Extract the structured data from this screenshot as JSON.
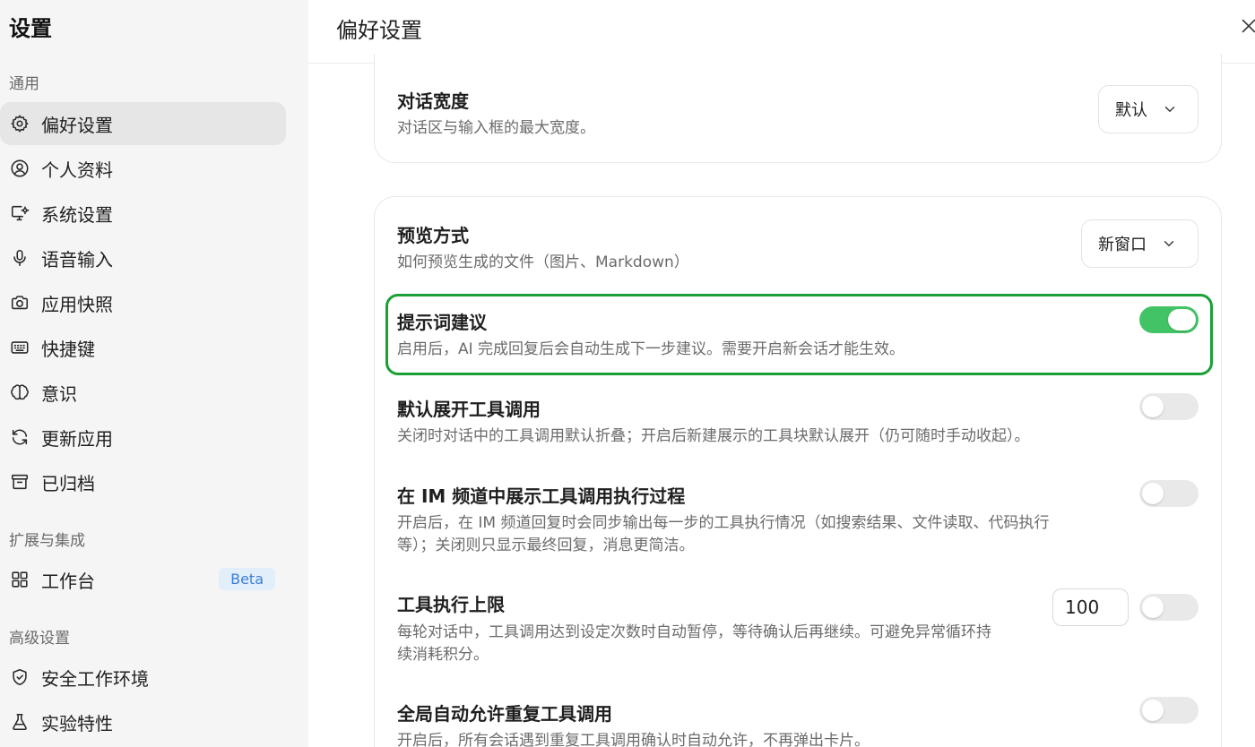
{
  "sidebar": {
    "title": "设置",
    "sections": {
      "general": "通用",
      "extensions": "扩展与集成",
      "advanced": "高级设置"
    },
    "items": [
      {
        "label": "偏好设置",
        "icon": "gear-icon"
      },
      {
        "label": "个人资料",
        "icon": "user-circle-icon"
      },
      {
        "label": "系统设置",
        "icon": "monitor-gear-icon"
      },
      {
        "label": "语音输入",
        "icon": "microphone-icon"
      },
      {
        "label": "应用快照",
        "icon": "camera-icon"
      },
      {
        "label": "快捷键",
        "icon": "keyboard-icon"
      },
      {
        "label": "意识",
        "icon": "brain-icon"
      },
      {
        "label": "更新应用",
        "icon": "refresh-icon"
      },
      {
        "label": "已归档",
        "icon": "archive-icon"
      },
      {
        "label": "工作台",
        "icon": "grid-icon",
        "badge": "Beta"
      },
      {
        "label": "安全工作环境",
        "icon": "shield-icon"
      },
      {
        "label": "实验特性",
        "icon": "flask-icon"
      }
    ]
  },
  "main": {
    "title": "偏好设置",
    "chat_width": {
      "title": "对话宽度",
      "desc": "对话区与输入框的最大宽度。",
      "value": "默认"
    },
    "preview": {
      "title": "预览方式",
      "desc": "如何预览生成的文件（图片、Markdown）",
      "value": "新窗口"
    },
    "prompt_suggest": {
      "title": "提示词建议",
      "desc": "启用后，AI 完成回复后会自动生成下一步建议。需要开启新会话才能生效。",
      "enabled": true
    },
    "expand_tools": {
      "title": "默认展开工具调用",
      "desc": "关闭时对话中的工具调用默认折叠；开启后新建展示的工具块默认展开（仍可随时手动收起）。",
      "enabled": false
    },
    "im_tools": {
      "title": "在 IM 频道中展示工具调用执行过程",
      "desc_line1": "开启后，在 IM 频道回复时会同步输出每一步的工具执行情况（如搜索结果、文件读取、代码执行",
      "desc_line2": "等）；关闭则只显示最终回复，消息更简洁。",
      "enabled": false
    },
    "tool_limit": {
      "title": "工具执行上限",
      "desc_line1": "每轮对话中，工具调用达到设定次数时自动暂停，等待确认后再继续。可避免异常循环持",
      "desc_line2": "续消耗积分。",
      "value": "100",
      "enabled": false
    },
    "auto_allow": {
      "title": "全局自动允许重复工具调用",
      "desc": "开启后，所有会话遇到重复工具调用确认时自动允许，不再弹出卡片。",
      "enabled": false
    }
  },
  "colors": {
    "toggle_on": "#42c466",
    "highlight": "#1aa036",
    "beta_bg": "#e3eefb",
    "beta_text": "#3b7fd6"
  }
}
